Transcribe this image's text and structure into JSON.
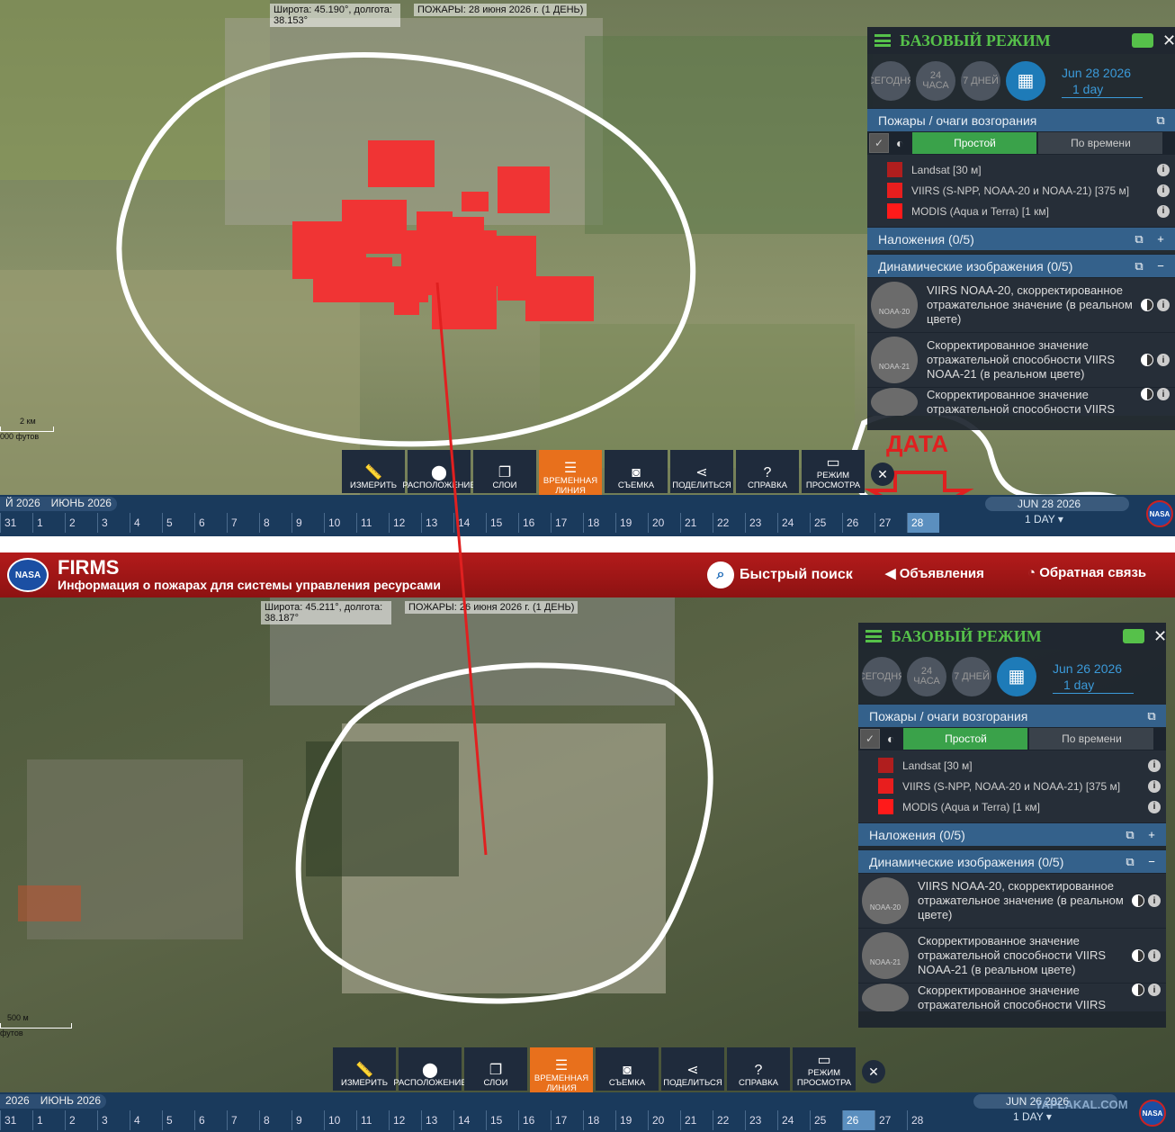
{
  "top": {
    "coords_text": "Широта: 45.190°, долгота:\n38.153°",
    "fires_text": "ПОЖАРЫ: 28 июня 2026 г. (1 ДЕНЬ)",
    "scale_km": "2 км",
    "scale_ft": "000 футов",
    "annotation_label": "ДАТА",
    "date_display": "Jun 28 2026",
    "date_period": "1 day",
    "timeline_months": [
      "Й 2026",
      "ИЮНЬ 2026"
    ],
    "timeline_days": [
      "31",
      "1",
      "2",
      "3",
      "4",
      "5",
      "6",
      "7",
      "8",
      "9",
      "10",
      "11",
      "12",
      "13",
      "14",
      "15",
      "16",
      "17",
      "18",
      "19",
      "20",
      "21",
      "22",
      "23",
      "24",
      "25",
      "26",
      "27",
      "28"
    ],
    "timeline_current_day": "28",
    "tl_date": "JUN 28 2026",
    "tl_period": "1 DAY"
  },
  "bottom": {
    "coords_text": "Широта: 45.211°, долгота:\n38.187°",
    "fires_text": "ПОЖАРЫ: 26 июня 2026 г. (1 ДЕНЬ)",
    "scale_km": "500 м",
    "scale_ft": "футов",
    "date_display": "Jun 26 2026",
    "date_period": "1 day",
    "timeline_months": [
      "2026",
      "ИЮНЬ 2026"
    ],
    "timeline_days": [
      "31",
      "1",
      "2",
      "3",
      "4",
      "5",
      "6",
      "7",
      "8",
      "9",
      "10",
      "11",
      "12",
      "13",
      "14",
      "15",
      "16",
      "17",
      "18",
      "19",
      "20",
      "21",
      "22",
      "23",
      "24",
      "25",
      "26",
      "27",
      "28"
    ],
    "timeline_current_day": "26",
    "tl_date": "JUN 26 2026",
    "tl_period": "1 DAY",
    "watermark": "YAPLAKAL.COM"
  },
  "header": {
    "logo": "NASA",
    "title": "FIRMS",
    "subtitle": "Информация о пожарах для системы управления ресурсами",
    "quick_search": "Быстрый поиск",
    "announcements": "Объявления",
    "feedback": "Обратная связь"
  },
  "panel": {
    "mode_title": "БАЗОВЫЙ РЕЖИМ",
    "btn_today": "СЕГОДНЯ",
    "btn_24h": "24 ЧАСА",
    "btn_7d": "7 ДНЕЙ",
    "fires_section": "Пожары / очаги возгорания",
    "tab_simple": "Простой",
    "tab_by_time": "По времени",
    "layers": [
      {
        "name": "Landsat [30 м]",
        "color": "#b01e1e"
      },
      {
        "name": "VIIRS (S-NPP, NOAA-20 и NOAA-21) [375 м]",
        "color": "#e81e1e"
      },
      {
        "name": "MODIS (Aqua и Terra) [1 км]",
        "color": "#ff1a1a"
      }
    ],
    "overlays_section": "Наложения (0/5)",
    "dynamic_section": "Динамические изображения (0/5)",
    "dynamic_items": [
      {
        "thumb": "NOAA-20",
        "text": "VIIRS NOAA-20, скорректированное отражательное значение (в реальном цвете)"
      },
      {
        "thumb": "NOAA-21",
        "text": "Скорректированное значение отражательной способности VIIRS NOAA-21 (в реальном цвете)"
      },
      {
        "thumb": "",
        "text": "Скорректированное значение отражательной способности VIIRS"
      }
    ]
  },
  "toolbar": {
    "items": [
      {
        "icon": "ruler-icon",
        "glyph": "📏",
        "label": "ИЗМЕРИТЬ"
      },
      {
        "icon": "location-pin-icon",
        "glyph": "📍",
        "label": "РАСПОЛОЖЕНИЕ"
      },
      {
        "icon": "layers-icon",
        "glyph": "❐",
        "label": "СЛОИ"
      },
      {
        "icon": "sliders-icon",
        "glyph": "☰",
        "label": "ВРЕМЕННАЯ ЛИНИЯ"
      },
      {
        "icon": "camera-icon",
        "glyph": "📷",
        "label": "СЪЕМКА"
      },
      {
        "icon": "share-icon",
        "glyph": "⋖",
        "label": "ПОДЕЛИТЬСЯ"
      },
      {
        "icon": "help-icon",
        "glyph": "?",
        "label": "СПРАВКА"
      },
      {
        "icon": "monitor-icon",
        "glyph": "▭",
        "label": "РЕЖИМ ПРОСМОТРА"
      }
    ],
    "active_index": 3
  },
  "colors": {
    "accent_green": "#56c14a",
    "fire_red": "#f03434",
    "header_red": "#b31b1b",
    "timeline_blue": "#1a3a5c",
    "section_blue": "#34618b"
  }
}
